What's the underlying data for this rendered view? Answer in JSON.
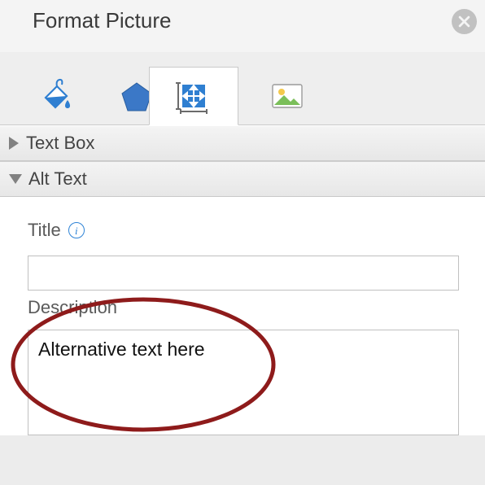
{
  "header": {
    "title": "Format Picture"
  },
  "tabs": {
    "fill": {
      "name": "fill-line-tab"
    },
    "effects": {
      "name": "effects-tab"
    },
    "size": {
      "name": "size-properties-tab"
    },
    "picture": {
      "name": "picture-tab"
    }
  },
  "sections": {
    "textbox": {
      "label": "Text Box"
    },
    "alttext": {
      "label": "Alt Text"
    }
  },
  "alttext": {
    "title_label": "Title",
    "title_value": "",
    "description_label": "Description",
    "description_value": "Alternative text here"
  }
}
